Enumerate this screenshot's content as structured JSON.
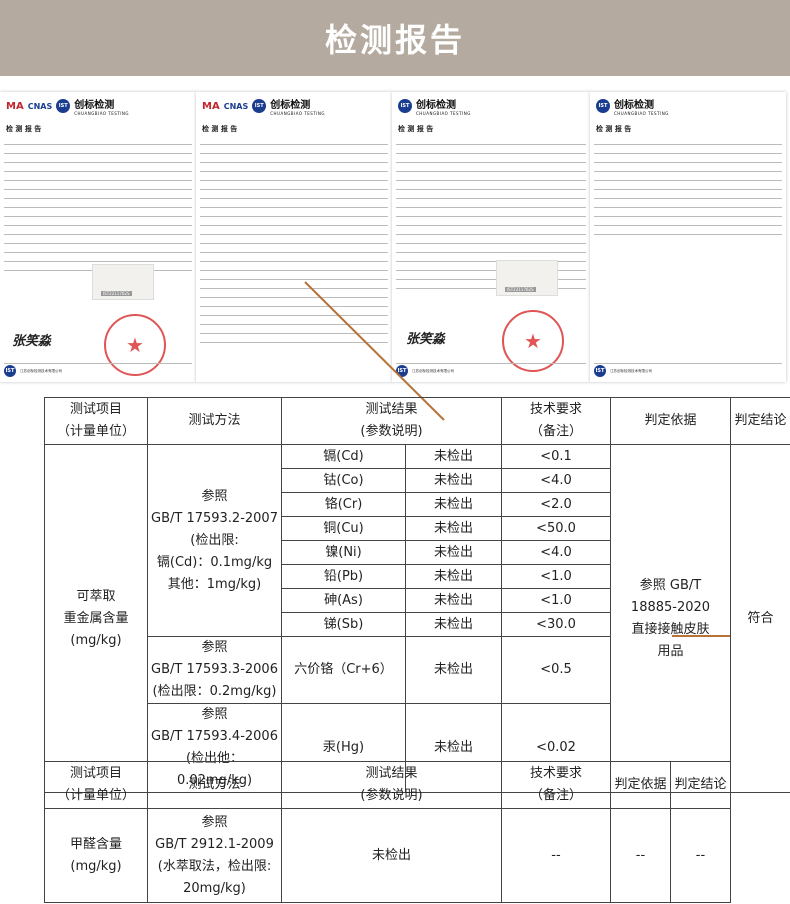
{
  "header": {
    "title": "检测报告"
  },
  "thumbnails": {
    "brand": "创标检测",
    "brand_en": "CHUANGBIAO TESTING",
    "report_title": "检 测 报 告",
    "ma_logo": "MA",
    "cnas_logo": "CNAS",
    "ist_logo": "IST",
    "sample_tag": "IST2211762S",
    "signature": "张笑淼",
    "footer_company": "江苏创标检测技术有限公司",
    "icons": [
      "ma-logo",
      "cnas-logo",
      "ist-logo",
      "seal-star"
    ]
  },
  "table1": {
    "headers": [
      "测试项目\n（计量单位）",
      "测试方法",
      "测试结果\n(参数说明)",
      "技术要求\n（备注）",
      "判定依据",
      "判定结论"
    ],
    "item": "可萃取\n重金属含量\n(mg/kg)",
    "method1": "参照\nGB/T 17593.2-2007\n(检出限:\n镉(Cd)：0.1mg/kg\n其他：1mg/kg)",
    "method2": "参照\nGB/T 17593.3-2006\n(检出限：0.2mg/kg)",
    "method3": "参照\nGB/T 17593.4-2006\n(检出他：0.02mg/kg)",
    "basis": "参照 GB/T\n18885-2020\n直接接触皮肤\n用品",
    "conclusion": "符合",
    "rows": [
      {
        "param": "镉(Cd)",
        "result": "未检出",
        "req": "<0.1"
      },
      {
        "param": "钴(Co)",
        "result": "未检出",
        "req": "<4.0"
      },
      {
        "param": "铬(Cr)",
        "result": "未检出",
        "req": "<2.0"
      },
      {
        "param": "铜(Cu)",
        "result": "未检出",
        "req": "<50.0"
      },
      {
        "param": "镍(Ni)",
        "result": "未检出",
        "req": "<4.0"
      },
      {
        "param": "铅(Pb)",
        "result": "未检出",
        "req": "<1.0"
      },
      {
        "param": "砷(As)",
        "result": "未检出",
        "req": "<1.0"
      },
      {
        "param": "锑(Sb)",
        "result": "未检出",
        "req": "<30.0"
      }
    ],
    "cr6": {
      "param": "六价铬（Cr+6）",
      "result": "未检出",
      "req": "<0.5"
    },
    "hg": {
      "param": "汞(Hg)",
      "result": "未检出",
      "req": "<0.02"
    }
  },
  "table2": {
    "headers": [
      "测试项目\n（计量单位）",
      "测试方法",
      "测试结果\n(参数说明)",
      "技术要求\n（备注）",
      "判定依据",
      "判定结论"
    ],
    "item": "甲醛含量\n(mg/kg)",
    "method": "参照\nGB/T 2912.1-2009\n(水萃取法，检出限:\n20mg/kg)",
    "result": "未检出",
    "req": "--",
    "basis": "--",
    "conclusion": "--"
  },
  "colors": {
    "banner": "#b5aa9f",
    "leader_line": "#b5733a",
    "seal": "#e05555"
  }
}
